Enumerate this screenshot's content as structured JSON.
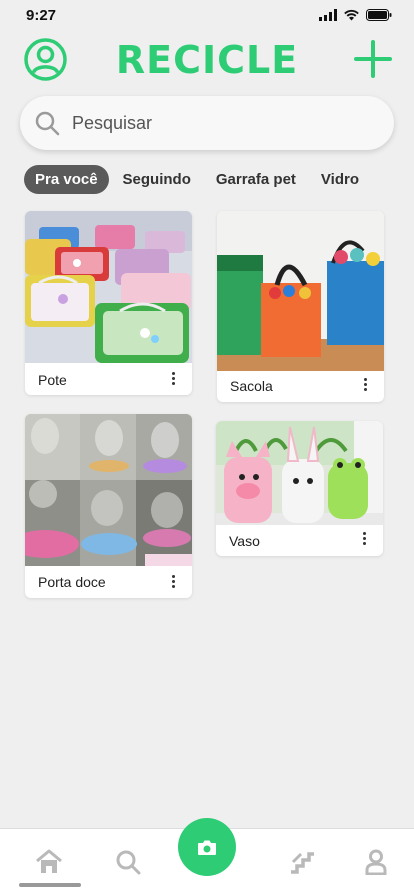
{
  "status_bar": {
    "time": "9:27"
  },
  "header": {
    "title": "RECICLE",
    "brand_color": "#2fcc76"
  },
  "search": {
    "placeholder": "Pesquisar"
  },
  "tabs": [
    {
      "label": "Pra você",
      "active": true
    },
    {
      "label": "Seguindo",
      "active": false
    },
    {
      "label": "Garrafa pet",
      "active": false
    },
    {
      "label": "Vidro",
      "active": false
    }
  ],
  "cards": [
    {
      "label": "Pote"
    },
    {
      "label": "Sacola"
    },
    {
      "label": "Porta doce"
    },
    {
      "label": "Vaso"
    }
  ],
  "bottom_nav": {
    "items": [
      "home-icon",
      "search-icon",
      "camera-icon",
      "stairs-icon",
      "user-icon"
    ]
  }
}
